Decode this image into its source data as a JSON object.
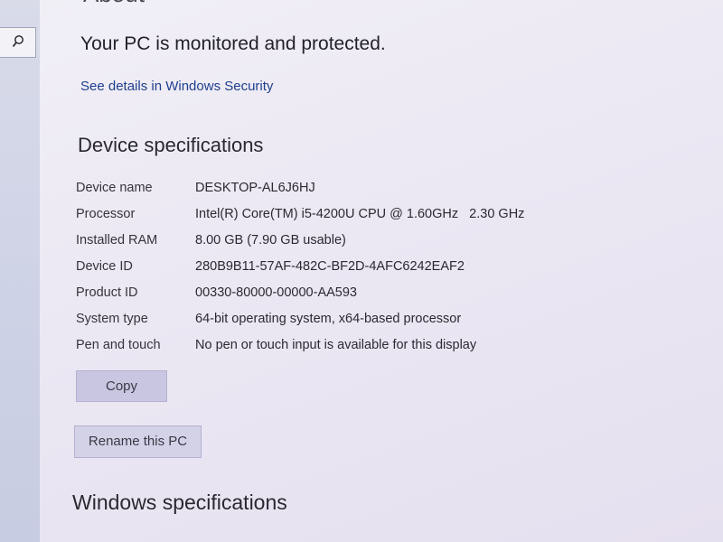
{
  "page": {
    "about_heading": "About",
    "protection_status": "Your PC is monitored and protected.",
    "security_link": "See details in Windows Security"
  },
  "sidebar": {
    "search_icon": "search-icon"
  },
  "device_specs": {
    "heading": "Device specifications",
    "rows": [
      {
        "label": "Device name",
        "value": "DESKTOP-AL6J6HJ"
      },
      {
        "label": "Processor",
        "value": "Intel(R) Core(TM) i5-4200U CPU @ 1.60GHz   2.30 GHz"
      },
      {
        "label": "Installed RAM",
        "value": "8.00 GB (7.90 GB usable)"
      },
      {
        "label": "Device ID",
        "value": "280B9B11-57AF-482C-BF2D-4AFC6242EAF2"
      },
      {
        "label": "Product ID",
        "value": "00330-80000-00000-AA593"
      },
      {
        "label": "System type",
        "value": "64-bit operating system, x64-based processor"
      },
      {
        "label": "Pen and touch",
        "value": "No pen or touch input is available for this display"
      }
    ],
    "copy_button": "Copy",
    "rename_button": "Rename this PC"
  },
  "windows_specs": {
    "heading": "Windows specifications"
  }
}
